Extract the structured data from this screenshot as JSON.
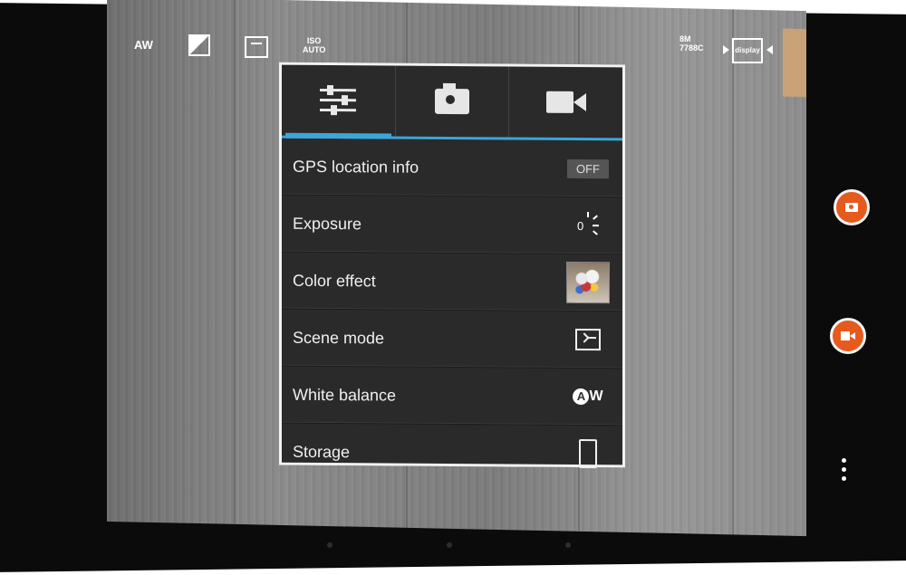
{
  "app": {
    "name": "Camera"
  },
  "top_bar": {
    "white_balance_icon": "auto-white-balance-icon",
    "white_balance_text": "AW",
    "exposure_icon": "exposure-compensation-icon",
    "scene_icon": "scene-mode-icon",
    "iso_top": "ISO",
    "iso_bottom": "AUTO",
    "storage_top": "8M",
    "storage_bottom": "7788C",
    "display_label": "display"
  },
  "panel": {
    "tabs": [
      {
        "name": "settings",
        "icon": "sliders-icon",
        "active": true
      },
      {
        "name": "photo",
        "icon": "camera-icon",
        "active": false
      },
      {
        "name": "video",
        "icon": "video-camera-icon",
        "active": false
      }
    ],
    "rows": [
      {
        "label": "GPS location info",
        "control": "OFF"
      },
      {
        "label": "Exposure",
        "control": "0"
      },
      {
        "label": "Color effect",
        "control": "flowers-thumbnail"
      },
      {
        "label": "Scene mode",
        "control": "scene-mode-icon"
      },
      {
        "label": "White balance",
        "control": "AW"
      },
      {
        "label": "Storage",
        "control": "phone-storage-icon"
      }
    ]
  },
  "side_controls": {
    "photo_shutter_icon": "camera-shutter-icon",
    "video_shutter_icon": "video-record-icon",
    "overflow_icon": "overflow-menu-icon"
  },
  "colors": {
    "accent": "#3aa6da",
    "shutter": "#e65a1e",
    "panel_bg": "#2a2a2a"
  }
}
